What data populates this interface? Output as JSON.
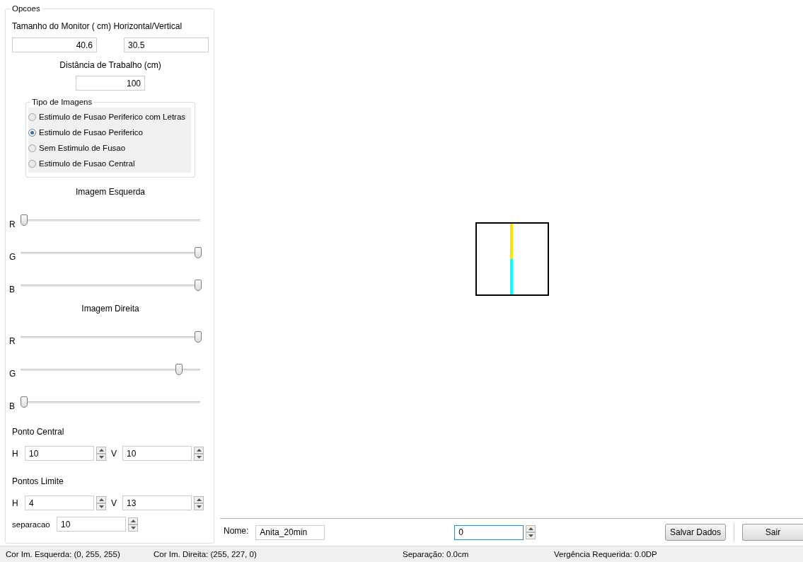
{
  "options": {
    "title": "Opcoes",
    "monitor_label": "Tamanho do Monitor ( cm) Horizontal/Vertical",
    "monitor_h": "40.6",
    "monitor_v": "30.5",
    "distance_label": "Distância de Trabalho (cm)",
    "distance": "100",
    "image_type": {
      "title": "Tipo de Imagens",
      "choices": [
        {
          "label": "Estimulo de Fusao Periferico com Letras",
          "selected": false
        },
        {
          "label": "Estimulo de Fusao Periferico",
          "selected": true
        },
        {
          "label": "Sem Estimulo de Fusao",
          "selected": false
        },
        {
          "label": "Estimulo de Fusao Central",
          "selected": false
        }
      ]
    },
    "left_image": {
      "title": "Imagem Esquerda",
      "sliders": [
        {
          "label": "R",
          "level": 0
        },
        {
          "label": "G",
          "level": 1
        },
        {
          "label": "B",
          "level": 1
        }
      ]
    },
    "right_image": {
      "title": "Imagem Direita",
      "sliders": [
        {
          "label": "R",
          "level": 1
        },
        {
          "label": "G",
          "level": 0.89
        },
        {
          "label": "B",
          "level": 0
        }
      ]
    },
    "central_point": {
      "title": "Ponto Central",
      "h_label": "H",
      "h": "10",
      "v_label": "V",
      "v": "10"
    },
    "limit_points": {
      "title": "Pontos Limite",
      "h_label": "H",
      "h": "4",
      "v_label": "V",
      "v": "13"
    },
    "separation": {
      "label": "separacao",
      "value": "10"
    }
  },
  "bottom": {
    "name_label": "Nome:",
    "name": "Anita_20min",
    "counter": "0",
    "buttons": [
      "Salvar Dados",
      "Sair"
    ]
  },
  "status_bar": [
    "Cor Im. Esquerda: (0, 255, 255)",
    "Cor Im. Direita: (255, 227, 0)",
    "Separação: 0.0cm",
    "Vergência Requerida: 0.0DP"
  ]
}
